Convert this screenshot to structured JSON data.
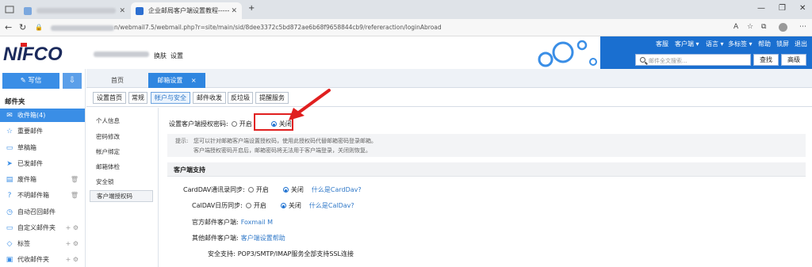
{
  "browser": {
    "tabs": [
      {
        "title_blurred": true,
        "closable": true
      },
      {
        "title": "企业邮局客户端设置教程----- 帮助中心",
        "closable": true
      }
    ],
    "url_prefix_blurred": true,
    "url_suffix": "n/webmail7.5/webmail.php?r=site/main/sid/8dee3372c5bd872ae6b68f9658844cb9/refereraction/loginAbroad"
  },
  "header": {
    "logo_text": "NIFCO",
    "switch_label": "换肤",
    "settings_label": "设置",
    "top_links": [
      "客服",
      "客户端 ▾",
      "语言 ▾",
      "多标签 ▾",
      "帮助",
      "锁屏",
      "退出"
    ],
    "search_placeholder": "邮件全文搜索...",
    "search_button": "查找",
    "advanced_button": "高级"
  },
  "sidebar": {
    "compose_label": "写信",
    "folders_title": "邮件夹",
    "folders": [
      {
        "label": "收件箱(4)",
        "icon": "inbox-icon",
        "selected": true
      },
      {
        "label": "重要邮件",
        "icon": "star-icon"
      },
      {
        "label": "草稿箱",
        "icon": "draft-icon"
      },
      {
        "label": "已发邮件",
        "icon": "sent-icon"
      },
      {
        "label": "废件箱",
        "icon": "trash-icon",
        "tail": "🗑"
      },
      {
        "label": "不明邮件箱",
        "icon": "question-icon",
        "tail": "🗑"
      },
      {
        "label": "自动召回邮件",
        "icon": "clock-icon"
      },
      {
        "label": "自定义邮件夹",
        "icon": "folder-icon",
        "tail": "+ ⚙"
      },
      {
        "label": "标签",
        "icon": "tag-icon",
        "tail": "+ ⚙"
      },
      {
        "label": "代收邮件夹",
        "icon": "mailbox-icon",
        "tail": "+ ⚙"
      }
    ]
  },
  "content_tabs": [
    {
      "label": "首页"
    },
    {
      "label": "邮箱设置",
      "active": true,
      "close": "×"
    }
  ],
  "sub_tabs": [
    {
      "label": "设置首页"
    },
    {
      "label": "常规"
    },
    {
      "label": "帐户与安全",
      "active": true
    },
    {
      "label": "邮件收发"
    },
    {
      "label": "反垃圾"
    },
    {
      "label": "提醒服务"
    }
  ],
  "settings_nav": [
    {
      "label": "个人信息"
    },
    {
      "label": "密码修改"
    },
    {
      "label": "帐户绑定"
    },
    {
      "label": "邮箱体检"
    },
    {
      "label": "安全锁"
    },
    {
      "label": "客户端授权码",
      "active": true
    }
  ],
  "auth_setting": {
    "label": "设置客户端授权密码:",
    "option_on": "开启",
    "option_off": "关闭",
    "selected": "off"
  },
  "hint": {
    "label": "提示:",
    "line1": "您可以针对邮箱客户端设置授权码，使用此授权码代替邮箱密码登录邮箱。",
    "line2": "客户端授权密码开启后，邮箱密码将无法用于客户端登录，关闭则恢复。"
  },
  "client_support": {
    "title": "客户端支持",
    "carddav": {
      "label": "CardDAV通讯录同步:",
      "option_on": "开启",
      "option_off": "关闭",
      "selected": "off",
      "link": "什么是CardDav?"
    },
    "caldav": {
      "label": "CalDAV日历同步:",
      "option_on": "开启",
      "option_off": "关闭",
      "selected": "off",
      "link": "什么是CalDav?"
    },
    "official_client": {
      "label": "官方邮件客户端:",
      "value": "Foxmail M"
    },
    "other_client": {
      "label": "其他邮件客户端:",
      "value": "客户端设置帮助"
    },
    "security": {
      "label": "安全支持:",
      "value": "POP3/SMTP/IMAP服务全部支持SSL连接"
    }
  },
  "colors": {
    "accent": "#1a6fd0",
    "annotation": "#e01f1f"
  }
}
